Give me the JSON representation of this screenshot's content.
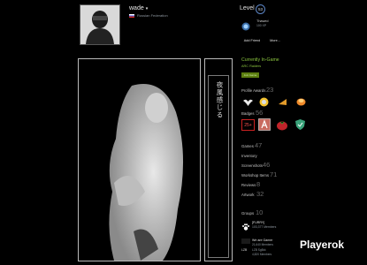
{
  "profile": {
    "username": "wade",
    "dropdown_glyph": "▾",
    "country": "Russian Federation"
  },
  "level": {
    "label": "Level",
    "value": "53"
  },
  "xp": {
    "title": "Thawed",
    "value": "100 XP"
  },
  "actions": {
    "add_friend": "Add Friend",
    "more": "More..."
  },
  "showcase": {
    "vertical_text": "夜風感じる"
  },
  "status": {
    "title": "Currently In-Game",
    "game": "ARC Raiders",
    "join_label": "Join Game"
  },
  "stats": {
    "awards_label": "Profile Awards",
    "awards_count": "23",
    "badges_label": "Badges",
    "badges_count": "56",
    "badge_25": "25+",
    "games_label": "Games",
    "games_count": "47",
    "inventory_label": "Inventory",
    "screenshots_label": "Screenshots",
    "screenshots_count": "46",
    "workshop_label": "Workshop Items",
    "workshop_count": "71",
    "reviews_label": "Reviews",
    "reviews_count": "8",
    "artwork_label": "Artwork",
    "artwork_count": "32",
    "groups_label": "Groups",
    "groups_count": "10"
  },
  "groups": [
    {
      "name": "[FURRY]",
      "members": "103,377 Members"
    },
    {
      "name": "We are Gamer",
      "tag": "LZB",
      "line1": "21,640 Members",
      "line2": "LZB Sg5kk",
      "line3": "4,820 Members"
    }
  ],
  "watermark": "Playerok",
  "colors": {
    "background": "#000000",
    "ingame_green": "#8bc53f",
    "join_button": "#5c7e10",
    "level_ring": "#5b84c4"
  }
}
